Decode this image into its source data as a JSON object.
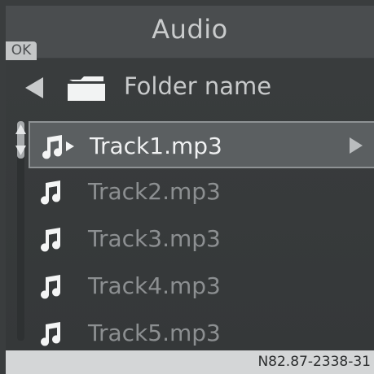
{
  "header": {
    "title": "Audio",
    "ok_label": "OK"
  },
  "folder": {
    "name": "Folder name",
    "back_icon": "left-arrow-icon",
    "folder_icon": "folder-icon"
  },
  "tracks": [
    {
      "label": "Track1.mp3",
      "selected": true,
      "playing": true
    },
    {
      "label": "Track2.mp3",
      "selected": false,
      "playing": false
    },
    {
      "label": "Track3.mp3",
      "selected": false,
      "playing": false
    },
    {
      "label": "Track4.mp3",
      "selected": false,
      "playing": false
    },
    {
      "label": "Track5.mp3",
      "selected": false,
      "playing": false
    }
  ],
  "footer": {
    "code": "N82.87-2338-31"
  },
  "colors": {
    "background": "#3a3d3e",
    "header": "#4a4d4f",
    "selected_row": "#5b5f61",
    "selected_text": "#f0f1f2",
    "dim_text": "#8c8f91",
    "icon": "#f4f5f5"
  }
}
